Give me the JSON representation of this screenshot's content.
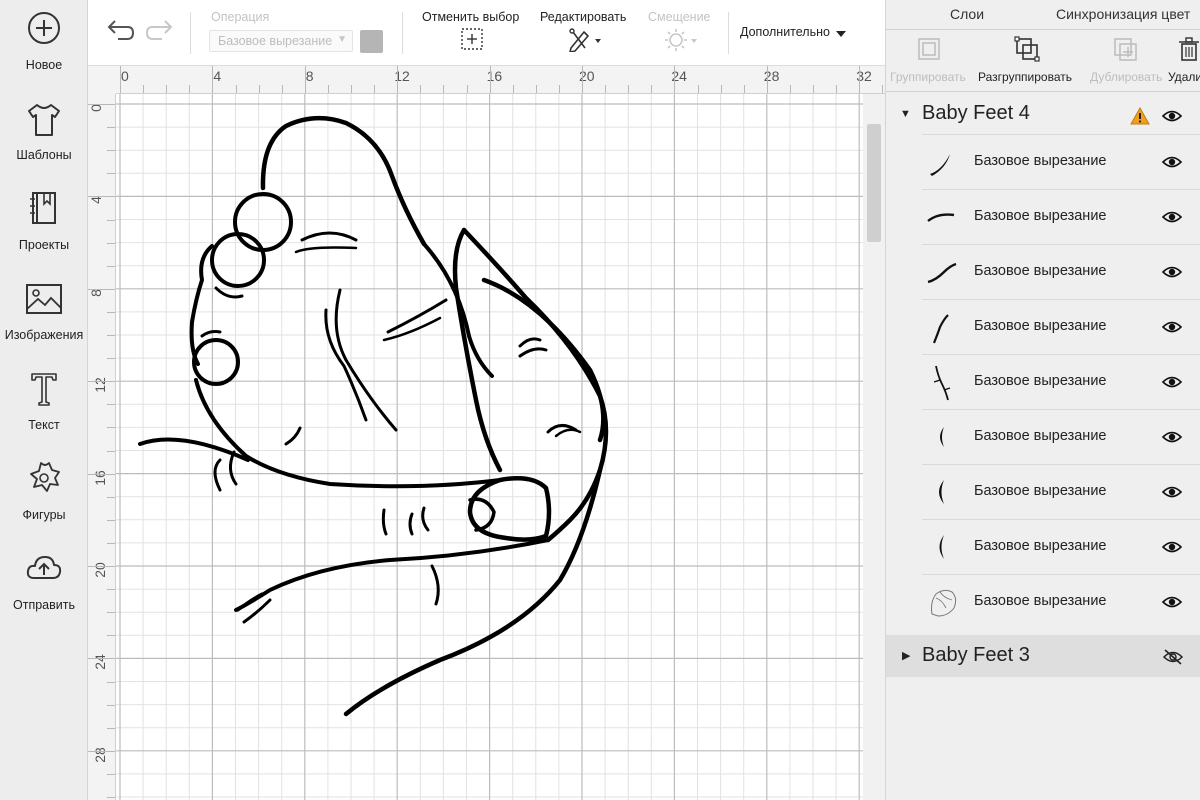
{
  "sidebar": {
    "items": [
      {
        "label": "Новое",
        "icon": "plus-circle-icon"
      },
      {
        "label": "Шаблоны",
        "icon": "tshirt-icon"
      },
      {
        "label": "Проекты",
        "icon": "notebook-icon"
      },
      {
        "label": "Изображения",
        "icon": "image-icon"
      },
      {
        "label": "Текст",
        "icon": "text-t-icon"
      },
      {
        "label": "Фигуры",
        "icon": "shapes-icon"
      },
      {
        "label": "Отправить",
        "icon": "cloud-upload-icon"
      }
    ]
  },
  "toolbar": {
    "undo_icon": "undo-icon",
    "redo_icon": "redo-icon",
    "operation_label": "Операция",
    "operation_value": "Базовое вырезание",
    "operation_color": "#b5b5b5",
    "deselect_label": "Отменить выбор",
    "edit_label": "Редактировать",
    "offset_label": "Смещение",
    "more_label": "Дополнительно"
  },
  "canvas": {
    "ruler_top_ticks": [
      "0",
      "4",
      "8",
      "12",
      "16",
      "20",
      "24",
      "28",
      "32"
    ],
    "ruler_left_ticks": [
      "0",
      "4",
      "8",
      "12",
      "16",
      "20",
      "24",
      "28"
    ]
  },
  "panel": {
    "tabs": [
      "Слои",
      "Синхронизация цвет"
    ],
    "tools": [
      {
        "label": "Группировать",
        "enabled": false,
        "icon": "group-icon"
      },
      {
        "label": "Разгруппировать",
        "enabled": true,
        "icon": "ungroup-icon"
      },
      {
        "label": "Дублировать",
        "enabled": false,
        "icon": "duplicate-icon"
      },
      {
        "label": "Удали",
        "enabled": true,
        "icon": "trash-icon"
      }
    ],
    "groups": [
      {
        "name": "Baby Feet 4",
        "expanded": true,
        "warning": true,
        "visible": true,
        "layers": [
          {
            "name": "Базовое вырезание"
          },
          {
            "name": "Базовое вырезание"
          },
          {
            "name": "Базовое вырезание"
          },
          {
            "name": "Базовое вырезание"
          },
          {
            "name": "Базовое вырезание"
          },
          {
            "name": "Базовое вырезание"
          },
          {
            "name": "Базовое вырезание"
          },
          {
            "name": "Базовое вырезание"
          },
          {
            "name": "Базовое вырезание"
          }
        ]
      },
      {
        "name": "Baby Feet 3",
        "expanded": false,
        "warning": false,
        "visible": false,
        "layers": []
      }
    ]
  },
  "colors": {
    "accent": "#222222",
    "warning": "#f0a020",
    "disabled_text": "#bdbdbd"
  }
}
